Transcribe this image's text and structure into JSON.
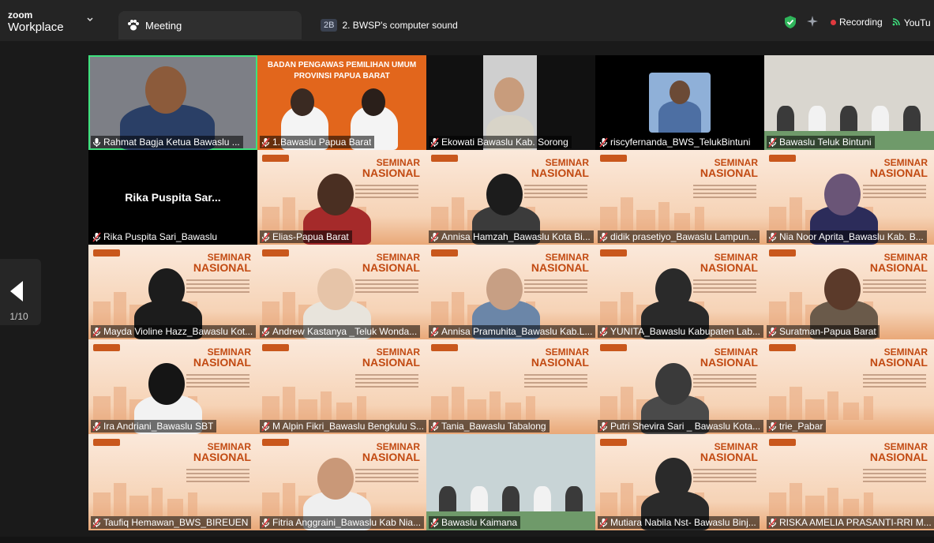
{
  "app": {
    "logo_top": "zoom",
    "logo_bottom": "Workplace"
  },
  "tabs": {
    "meeting": "Meeting",
    "sound_badge": "2B",
    "sound": "2. BWSP's computer sound"
  },
  "status": {
    "recording": "Recording",
    "youtube": "YouTu"
  },
  "pager": {
    "page": "1/10"
  },
  "colors": {
    "active_border": "#3ee27e",
    "record": "#e0393e",
    "seminar_title": "#c24a12"
  },
  "seminar": {
    "line1": "SEMINAR",
    "line2": "NASIONAL"
  },
  "participants": [
    {
      "name": "Rahmat Bagja Ketua Bawaslu ...",
      "kind": "video",
      "bg": "#7d7f86",
      "person": "#2a3f66",
      "head": "#8c5b3b",
      "active": true,
      "mic": "on"
    },
    {
      "name": "1.Bawaslu Papua Barat",
      "kind": "banner",
      "banner": "BADAN PENGAWAS PEMILIHAN UMUM PROVINSI PAPUA BARAT",
      "mic": "off"
    },
    {
      "name": "Ekowati Bawaslu Kab. Sorong",
      "kind": "video",
      "bg": "#cfcfcf",
      "person": "#d8d4c8",
      "head": "#c89c7c",
      "mic": "off"
    },
    {
      "name": "riscyfernanda_BWS_TelukBintuni",
      "kind": "photo",
      "bg": "#000000",
      "person": "#4d6fa3",
      "head": "#6b4a36",
      "mic": "off"
    },
    {
      "name": "Bawaslu Teluk Bintuni",
      "kind": "room",
      "bg": "#d9d6cf",
      "mic": "off"
    },
    {
      "name": "Rika Puspita Sari_Bawaslu",
      "kind": "black",
      "display": "Rika Puspita Sar...",
      "mic": "off"
    },
    {
      "name": "Elias-Papua Barat",
      "kind": "seminar-person",
      "person": "#a52a2a",
      "head": "#4a2f22",
      "mic": "off"
    },
    {
      "name": "Annisa Hamzah_Bawaslu Kota Bi...",
      "kind": "seminar-person",
      "person": "#3b3b3b",
      "head": "#1c1c1c",
      "mic": "off"
    },
    {
      "name": "didik prasetiyo_Bawaslu Lampun...",
      "kind": "seminar",
      "mic": "off"
    },
    {
      "name": "Nia Noor Aprita_Bawaslu Kab. B...",
      "kind": "seminar-person",
      "person": "#2c2c5a",
      "head": "#6a5577",
      "mic": "off"
    },
    {
      "name": "Mayda Violine Hazz_Bawaslu Kot...",
      "kind": "seminar-person",
      "person": "#1c1c1c",
      "head": "#1c1c1c",
      "mic": "off"
    },
    {
      "name": "Andrew Kastanya _Teluk Wonda...",
      "kind": "seminar-person",
      "person": "#e8e4dc",
      "head": "#e6c4a8",
      "mic": "off"
    },
    {
      "name": "Annisa Pramuhita_Bawaslu Kab.L...",
      "kind": "seminar-person",
      "person": "#6b86a8",
      "head": "#c79f84",
      "mic": "off"
    },
    {
      "name": "YUNITA_Bawaslu Kabupaten Lab...",
      "kind": "seminar-person",
      "person": "#2a2a2a",
      "head": "#2a2a2a",
      "mic": "off"
    },
    {
      "name": "Suratman-Papua Barat",
      "kind": "seminar-person",
      "person": "#6a5a4a",
      "head": "#5b3a2a",
      "mic": "off"
    },
    {
      "name": "Ira Andriani_Bawaslu SBT",
      "kind": "seminar-person",
      "person": "#f2f2f2",
      "head": "#151515",
      "mic": "off"
    },
    {
      "name": "M Alpin Fikri_Bawaslu Bengkulu S...",
      "kind": "seminar",
      "mic": "off"
    },
    {
      "name": "Tania_Bawaslu Tabalong",
      "kind": "seminar",
      "mic": "off"
    },
    {
      "name": "Putri Shevira Sari _ Bawaslu Kota...",
      "kind": "seminar-person",
      "person": "#4a4a4a",
      "head": "#3a3a3a",
      "mic": "off"
    },
    {
      "name": "trie_Pabar",
      "kind": "seminar",
      "mic": "off"
    },
    {
      "name": "Taufiq Hemawan_BWS_BIREUEN",
      "kind": "seminar",
      "mic": "off"
    },
    {
      "name": "Fitria Anggraini_Bawaslu Kab Nia...",
      "kind": "seminar-person",
      "person": "#efefef",
      "head": "#c99878",
      "mic": "off"
    },
    {
      "name": "Bawaslu Kaimana",
      "kind": "room",
      "bg": "#c8d4d6",
      "mic": "off"
    },
    {
      "name": "Mutiara Nabila Nst- Bawaslu Binj...",
      "kind": "seminar-person",
      "person": "#2a2a2a",
      "head": "#2a2a2a",
      "mic": "off"
    },
    {
      "name": "RISKA AMELIA PRASANTI-RRI M...",
      "kind": "seminar",
      "mic": "off"
    }
  ]
}
